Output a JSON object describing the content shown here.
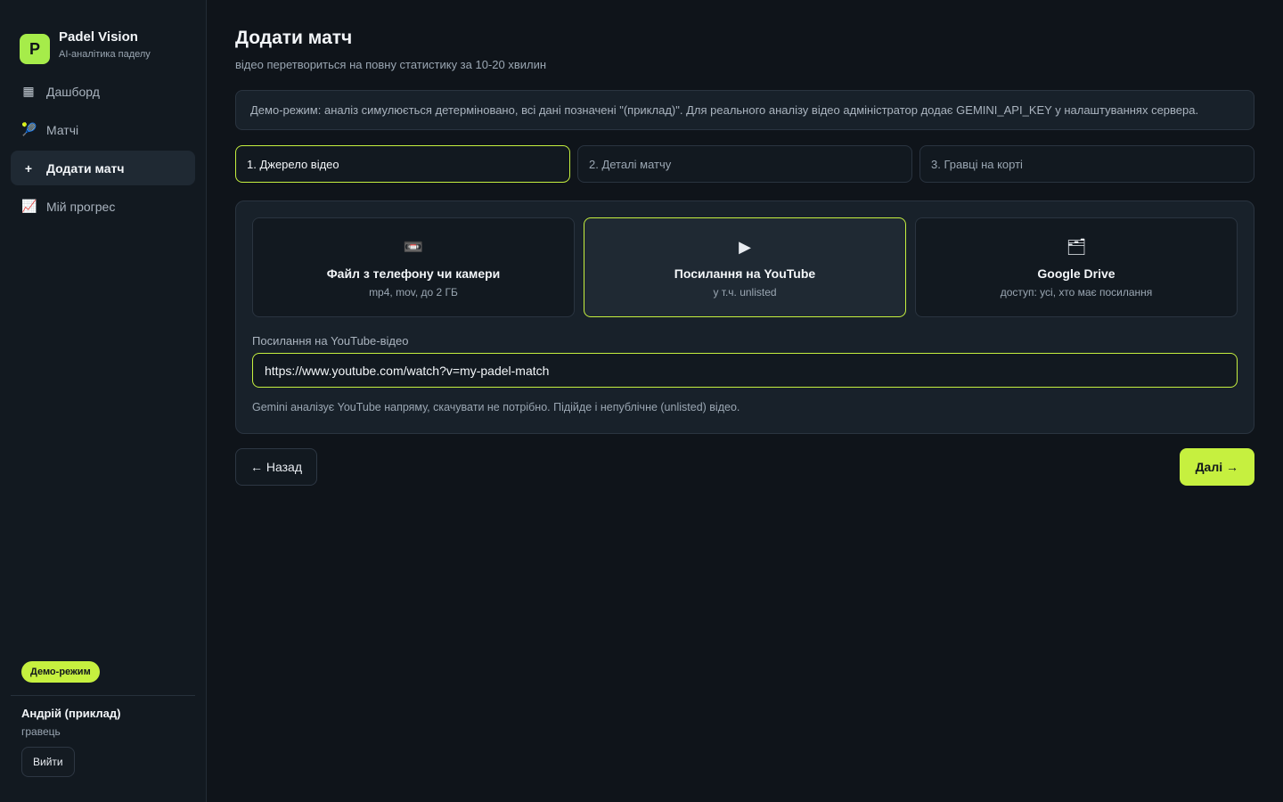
{
  "brand": {
    "logo_letter": "P",
    "name": "Padel Vision",
    "subtitle": "AI-аналітика паделу"
  },
  "nav": {
    "items": [
      {
        "label": "Дашборд",
        "icon": "▦",
        "icon_name": "dashboard-grid-icon"
      },
      {
        "label": "Матчі",
        "icon": "🎾",
        "icon_name": "tennis-racket-icon"
      },
      {
        "label": "Додати матч",
        "icon": "+",
        "icon_name": "plus-icon"
      },
      {
        "label": "Мій прогрес",
        "icon": "📈",
        "icon_name": "chart-up-icon"
      }
    ],
    "active_index": 2
  },
  "sidebar_footer": {
    "demo_badge": "Демо-режим",
    "user_name": "Андрій (приклад)",
    "user_role": "гравець",
    "logout_label": "Вийти"
  },
  "page": {
    "title": "Додати матч",
    "subtitle": "відео перетвориться на повну статистику за 10-20 хвилин",
    "notice": "Демо-режим: аналіз симулюється детерміновано, всі дані позначені \"(приклад)\". Для реального аналізу відео адміністратор додає GEMINI_API_KEY у налаштуваннях сервера."
  },
  "steps": [
    {
      "label": "1. Джерело відео"
    },
    {
      "label": "2. Деталі матчу"
    },
    {
      "label": "3. Гравці на корті"
    }
  ],
  "active_step": 0,
  "sources": [
    {
      "icon": "📼",
      "icon_name": "videocassette-icon",
      "title": "Файл з телефону чи камери",
      "desc": "mp4, mov, до 2 ГБ"
    },
    {
      "icon": "▶",
      "icon_name": "play-icon",
      "title": "Посилання на YouTube",
      "desc": "у т.ч. unlisted"
    },
    {
      "icon": "🗂",
      "icon_name": "folder-icon",
      "title": "Google Drive",
      "desc": "доступ: усі, хто має посилання"
    }
  ],
  "active_source": 1,
  "url_field": {
    "label": "Посилання на YouTube-відео",
    "value": "https://www.youtube.com/watch?v=my-padel-match",
    "hint": "Gemini аналізує YouTube напряму, скачувати не потрібно. Підійде і непублічне (unlisted) відео."
  },
  "actions": {
    "back_label": "← Назад",
    "next_label": "Далі →"
  },
  "colors": {
    "accent": "#c6f03f",
    "logo_bg": "#a6ec4a",
    "background": "#0f141a",
    "sidebar_bg": "#121920",
    "card_bg": "#18212a"
  }
}
